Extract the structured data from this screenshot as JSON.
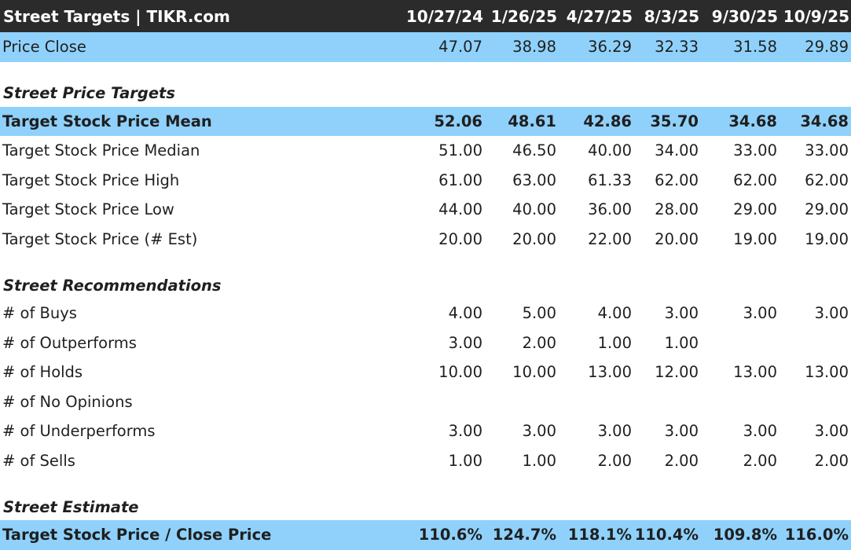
{
  "title": "Street Targets | TIKR.com",
  "columns": [
    "10/27/24",
    "1/26/25",
    "4/27/25",
    "8/3/25",
    "9/30/25",
    "10/9/25"
  ],
  "price_close": {
    "label": "Price Close",
    "values": [
      "47.07",
      "38.98",
      "36.29",
      "32.33",
      "31.58",
      "29.89"
    ]
  },
  "section_targets": "Street Price Targets",
  "targets": [
    {
      "label": "Target Stock Price Mean",
      "values": [
        "52.06",
        "48.61",
        "42.86",
        "35.70",
        "34.68",
        "34.68"
      ]
    },
    {
      "label": "Target Stock Price Median",
      "values": [
        "51.00",
        "46.50",
        "40.00",
        "34.00",
        "33.00",
        "33.00"
      ]
    },
    {
      "label": "Target Stock Price High",
      "values": [
        "61.00",
        "63.00",
        "61.33",
        "62.00",
        "62.00",
        "62.00"
      ]
    },
    {
      "label": "Target Stock Price Low",
      "values": [
        "44.00",
        "40.00",
        "36.00",
        "28.00",
        "29.00",
        "29.00"
      ]
    },
    {
      "label": "Target Stock Price (# Est)",
      "values": [
        "20.00",
        "20.00",
        "22.00",
        "20.00",
        "19.00",
        "19.00"
      ]
    }
  ],
  "section_recs": "Street Recommendations",
  "recs": [
    {
      "label": "# of Buys",
      "values": [
        "4.00",
        "5.00",
        "4.00",
        "3.00",
        "3.00",
        "3.00"
      ]
    },
    {
      "label": "# of Outperforms",
      "values": [
        "3.00",
        "2.00",
        "1.00",
        "1.00",
        "",
        ""
      ]
    },
    {
      "label": "# of Holds",
      "values": [
        "10.00",
        "10.00",
        "13.00",
        "12.00",
        "13.00",
        "13.00"
      ]
    },
    {
      "label": "# of No Opinions",
      "values": [
        "",
        "",
        "",
        "",
        "",
        ""
      ]
    },
    {
      "label": "# of Underperforms",
      "values": [
        "3.00",
        "3.00",
        "3.00",
        "3.00",
        "3.00",
        "3.00"
      ]
    },
    {
      "label": "# of Sells",
      "values": [
        "1.00",
        "1.00",
        "2.00",
        "2.00",
        "2.00",
        "2.00"
      ]
    }
  ],
  "section_estimate": "Street Estimate",
  "estimate": {
    "label": "Target Stock Price / Close Price",
    "values": [
      "110.6%",
      "124.7%",
      "118.1%",
      "110.4%",
      "109.8%",
      "116.0%"
    ]
  }
}
